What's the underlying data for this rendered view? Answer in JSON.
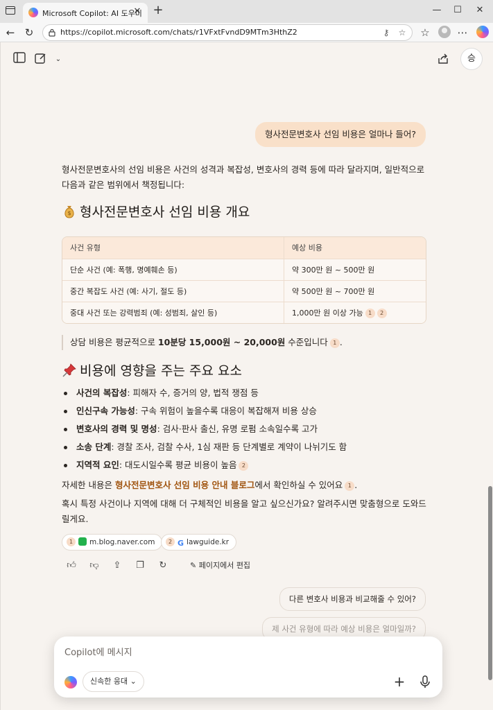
{
  "browser": {
    "tab_title": "Microsoft Copilot: AI 도우미",
    "url": "https://copilot.microsoft.com/chats/r1VFxtFvndD9MTm3HthZ2"
  },
  "header": {
    "profile_initial": "승"
  },
  "chat": {
    "user_message": "형사전문변호사 선임 비용은 얼마나 들어?",
    "intro": "형사전문변호사의 선임 비용은 사건의 성격과 복잡성, 변호사의 경력 등에 따라 달라지며, 일반적으로 다음과 같은 범위에서 책정됩니다:",
    "heading1": "형사전문변호사 선임 비용 개요",
    "table": {
      "headers": [
        "사건 유형",
        "예상 비용"
      ],
      "rows": [
        [
          "단순 사건 (예: 폭행, 명예훼손 등)",
          "약 300만 원 ~ 500만 원"
        ],
        [
          "중간 복잡도 사건 (예: 사기, 절도 등)",
          "약 500만 원 ~ 700만 원"
        ],
        [
          "중대 사건 또는 강력범죄 (예: 성범죄, 살인 등)",
          "1,000만 원 이상 가능"
        ]
      ],
      "row3_citations": [
        "1",
        "2"
      ]
    },
    "quote": {
      "prefix": "상담 비용은 평균적으로 ",
      "bold": "10분당 15,000원 ~ 20,000원",
      "suffix": " 수준입니다",
      "citation": "1"
    },
    "heading2": "비용에 영향을 주는 주요 요소",
    "bullets": [
      {
        "bold": "사건의 복잡성",
        "text": ": 피해자 수, 증거의 양, 법적 쟁점 등",
        "citation": ""
      },
      {
        "bold": "인신구속 가능성",
        "text": ": 구속 위험이 높을수록 대응이 복잡해져 비용 상승",
        "citation": ""
      },
      {
        "bold": "변호사의 경력 및 명성",
        "text": ": 검사·판사 출신, 유명 로펌 소속일수록 고가",
        "citation": ""
      },
      {
        "bold": "소송 단계",
        "text": ": 경찰 조사, 검찰 수사, 1심 재판 등 단계별로 계약이 나뉘기도 함",
        "citation": ""
      },
      {
        "bold": "지역적 요인",
        "text": ": 대도시일수록 평균 비용이 높음",
        "citation": "2"
      }
    ],
    "details": {
      "prefix": "자세한 내용은 ",
      "link": "형사전문변호사 선임 비용 안내 블로그",
      "suffix": "에서 확인하실 수 있어요",
      "citation": "1"
    },
    "closing": "혹시 특정 사건이나 지역에 대해 더 구체적인 비용을 알고 싶으신가요? 알려주시면 맞춤형으로 도와드릴게요.",
    "sources": [
      {
        "num": "1",
        "label": "m.blog.naver.com",
        "icon": "naver-blog-icon",
        "color": "#22b14c"
      },
      {
        "num": "2",
        "label": "lawguide.kr",
        "icon": "google-g-icon",
        "color": "#4285f4"
      }
    ],
    "edit_label": "페이지에서 편집"
  },
  "suggestions": [
    "다른 변호사 비용과 비교해줄 수 있어?",
    "제 사건 유형에 따라 예상 비용은 얼마일까?"
  ],
  "composer": {
    "placeholder": "Copilot에 메시지",
    "mode": "신속한 응대"
  },
  "colors": {
    "user_bubble": "#f9e0c9",
    "link": "#a0540f",
    "background": "#f7f3ef"
  }
}
